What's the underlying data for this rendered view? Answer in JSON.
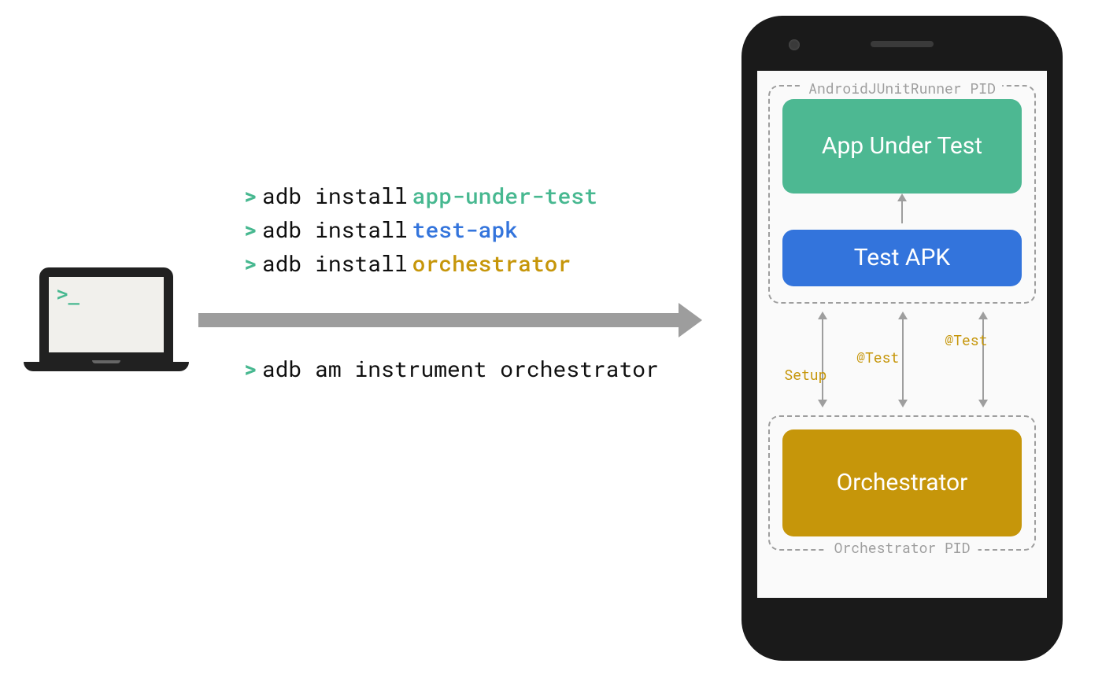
{
  "terminal": {
    "prompt": ">",
    "line1": {
      "cmd": "adb install",
      "highlight": "app-under-test"
    },
    "line2": {
      "cmd": "adb install",
      "highlight": "test-apk"
    },
    "line3": {
      "cmd": "adb install",
      "highlight": "orchestrator"
    },
    "line4": {
      "cmd": "adb am instrument orchestrator"
    }
  },
  "phone": {
    "pid_top_label": "AndroidJUnitRunner PID",
    "pid_bottom_label": "Orchestrator PID",
    "block_app": "App Under Test",
    "block_test": "Test APK",
    "block_orch": "Orchestrator",
    "arrow_setup": "Setup",
    "arrow_test1": "@Test",
    "arrow_test2": "@Test"
  }
}
